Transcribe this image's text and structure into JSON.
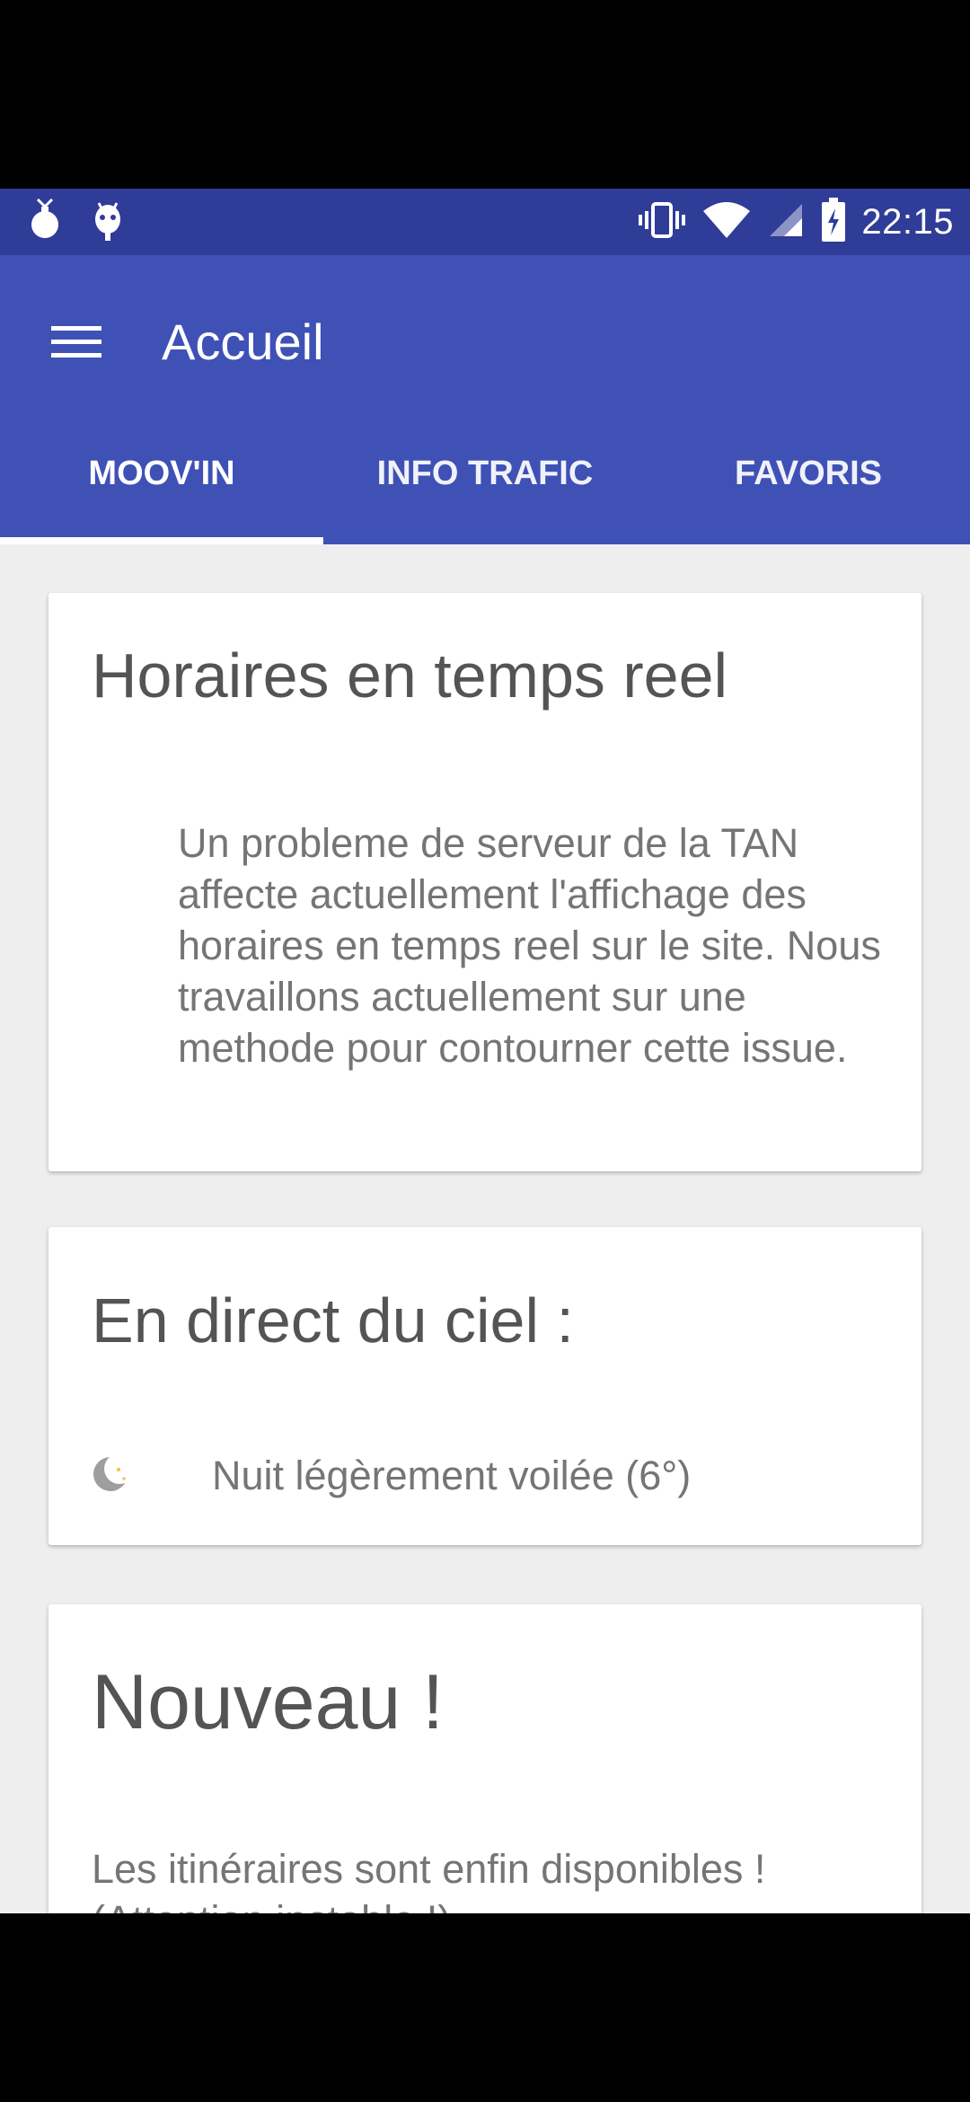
{
  "status_bar": {
    "time": "22:15",
    "left_icons": [
      "bomb-icon",
      "android-debug-icon"
    ],
    "right_icons": [
      "vibrate-icon",
      "wifi-icon",
      "cell-signal-icon",
      "battery-charging-icon"
    ]
  },
  "app_bar": {
    "menu_icon": "hamburger-menu-icon",
    "title": "Accueil",
    "color": "#3f51b5",
    "status_color": "#2f3c98"
  },
  "tabs": [
    {
      "label": "MOOV'IN",
      "selected": true
    },
    {
      "label": "INFO TRAFIC",
      "selected": false
    },
    {
      "label": "FAVORIS",
      "selected": false
    }
  ],
  "cards": {
    "realtime": {
      "title": "Horaires en temps reel",
      "body": "Un probleme de serveur de la TAN affecte actuellement l'affichage des horaires en temps reel sur le site. Nous travaillons actuellement sur une methode pour contourner cette issue."
    },
    "sky": {
      "title": "En direct du ciel :",
      "weather_icon": "moon-icon",
      "weather_text": "Nuit légèrement voilée (6°)"
    },
    "news": {
      "title": "Nouveau !",
      "body": "Les itinéraires sont enfin disponibles ! (Attention instable !)"
    }
  }
}
